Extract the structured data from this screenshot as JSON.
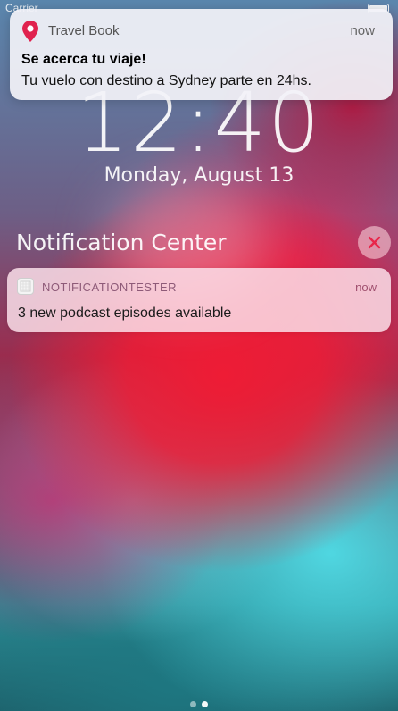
{
  "status_bar": {
    "carrier": "Carrier"
  },
  "lock_screen": {
    "time": "12:40",
    "date": "Monday, August 13"
  },
  "banner": {
    "app_name": "Travel Book",
    "time": "now",
    "title": "Se acerca tu viaje!",
    "body": "Tu vuelo con destino a Sydney parte en 24hs.",
    "icon": "map-pin-icon",
    "icon_color": "#e0224e"
  },
  "notification_center": {
    "title": "Notification Center",
    "clear_icon": "close-icon",
    "clear_icon_color": "#e8264a",
    "notifications": [
      {
        "app_name": "NOTIFICATIONTESTER",
        "time": "now",
        "body": "3 new podcast episodes available",
        "icon": "app-icon"
      }
    ]
  },
  "page_indicator": {
    "pages": 2,
    "current": 2
  }
}
